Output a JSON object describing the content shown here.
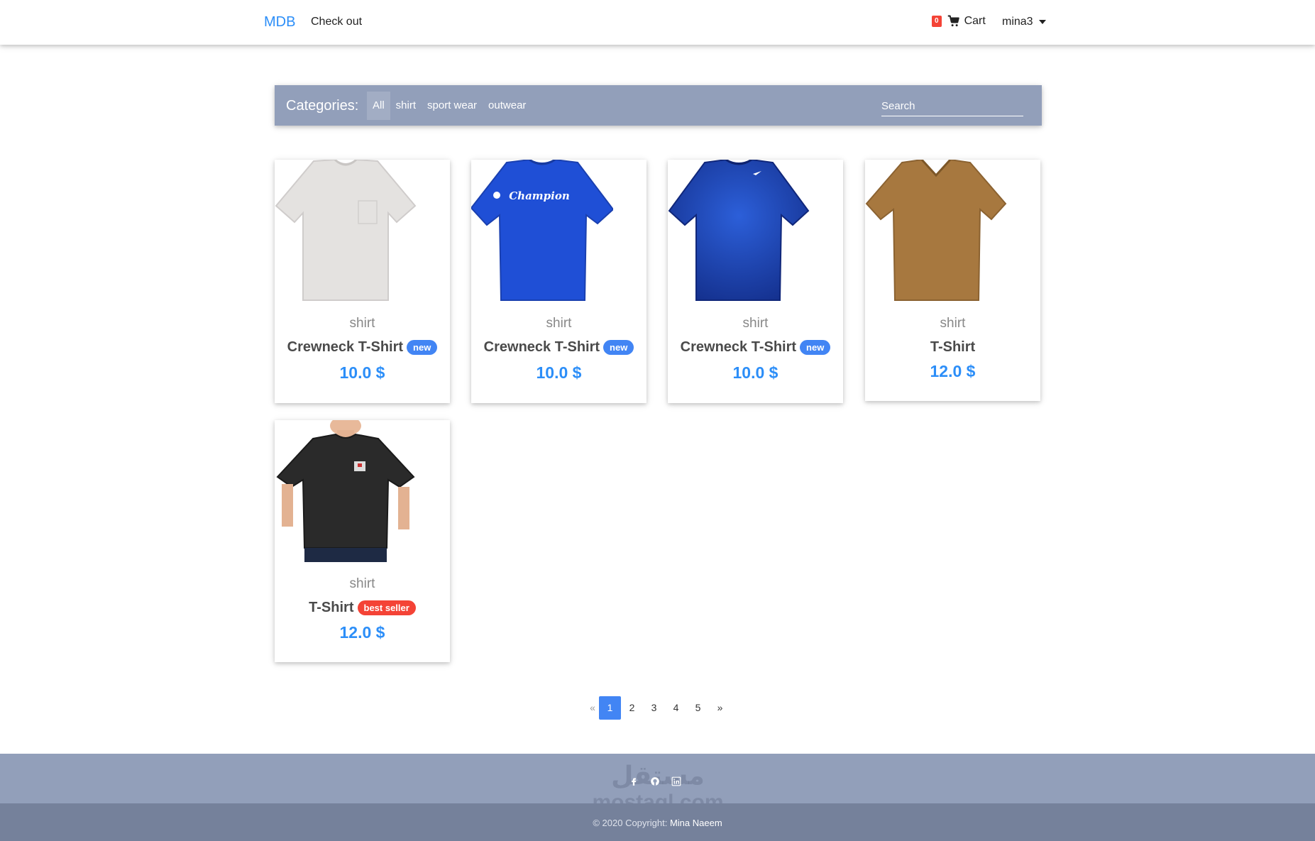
{
  "navbar": {
    "brand": "MDB",
    "checkout": "Check out",
    "cart_count": "0",
    "cart_label": "Cart",
    "user": "mina3"
  },
  "categories": {
    "title": "Categories:",
    "items": [
      "All",
      "shirt",
      "sport wear",
      "outwear"
    ],
    "search_placeholder": "Search"
  },
  "products": [
    {
      "category": "shirt",
      "name": "Crewneck T-Shirt",
      "badge": "new",
      "price": "10.0 $",
      "image": "white-tshirt"
    },
    {
      "category": "shirt",
      "name": "Crewneck T-Shirt",
      "badge": "new",
      "price": "10.0 $",
      "image": "blue-champion-tshirt"
    },
    {
      "category": "shirt",
      "name": "Crewneck T-Shirt",
      "badge": "new",
      "price": "10.0 $",
      "image": "navy-sport-tshirt"
    },
    {
      "category": "shirt",
      "name": "T-Shirt",
      "badge": "",
      "price": "12.0 $",
      "image": "brown-vneck-tshirt"
    },
    {
      "category": "shirt",
      "name": "T-Shirt",
      "badge": "best seller",
      "price": "12.0 $",
      "image": "black-pocket-tshirt"
    }
  ],
  "pagination": {
    "prev": "«",
    "pages": [
      "1",
      "2",
      "3",
      "4",
      "5"
    ],
    "next": "»",
    "current": "1"
  },
  "footer": {
    "icons": [
      "facebook-icon",
      "github-icon",
      "linkedin-icon"
    ],
    "copyright_prefix": "© 2020 Copyright:",
    "copyright_name": "Mina Naeem",
    "watermark_top": "مستقل",
    "watermark_bottom": "mostaql.com"
  },
  "colors": {
    "accent": "#2c8ef8",
    "category_bar": "#929fba",
    "badge_new": "#4285f4",
    "badge_best": "#f44336"
  }
}
